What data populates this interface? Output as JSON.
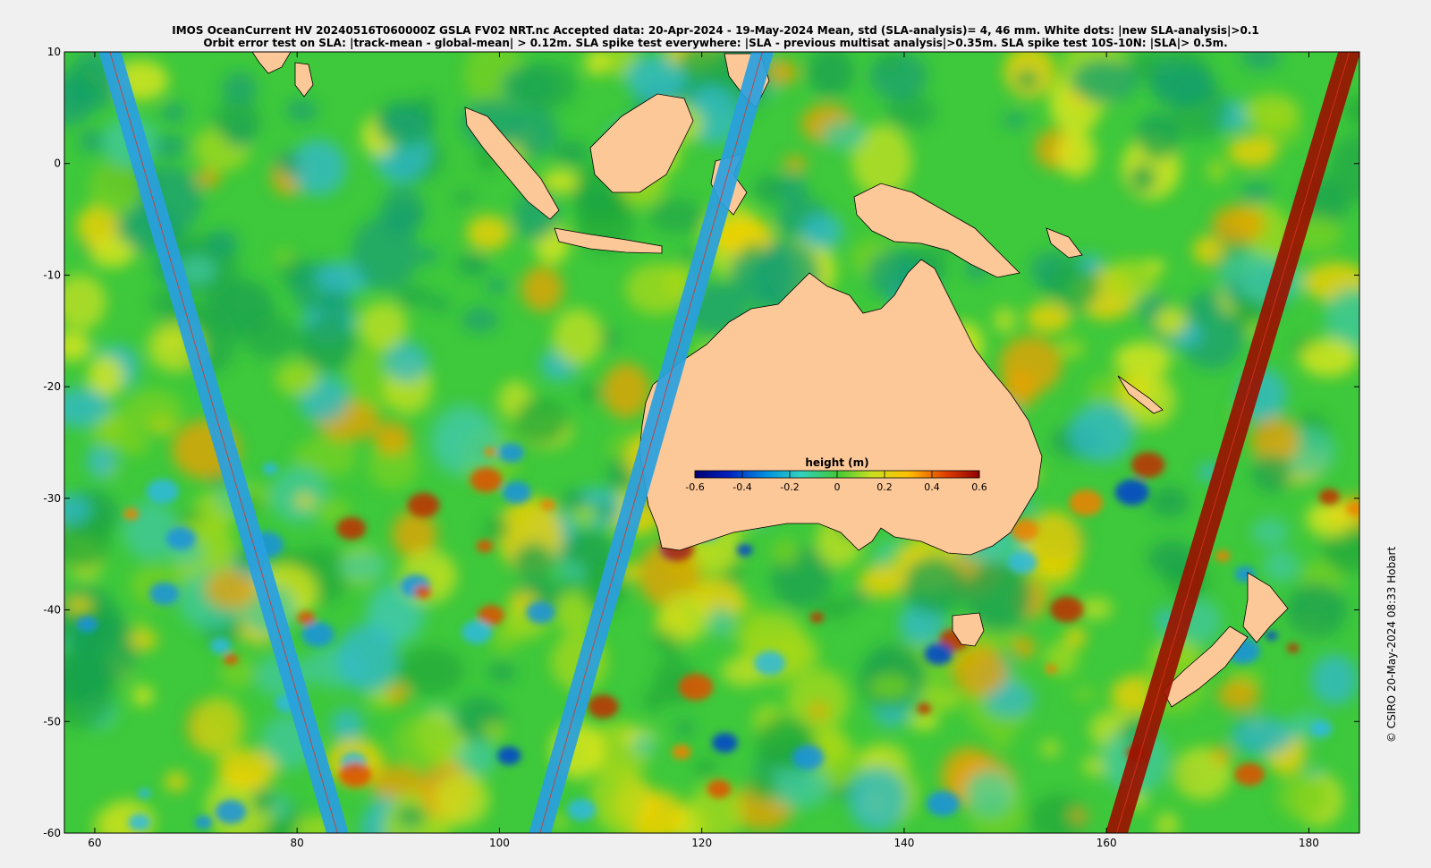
{
  "header": {
    "title_line1": "IMOS OceanCurrent HV 20240516T060000Z GSLA FV02 NRT.nc  Accepted data: 20-Apr-2024 - 19-May-2024 Mean, std (SLA-analysis)= 4, 46 mm. White dots: |new SLA-analysis|>0.1",
    "title_line2": "Orbit error test on SLA: |track-mean  - global-mean| > 0.12m.  SLA spike test everywhere: |SLA - previous multisat analysis|>0.35m. SLA spike test 10S-10N: |SLA|> 0.5m."
  },
  "map": {
    "x_ticks": [
      "60",
      "80",
      "100",
      "120",
      "140",
      "160",
      "180"
    ],
    "y_ticks": [
      "10",
      "0",
      "-10",
      "-20",
      "-30",
      "-40",
      "-50",
      "-60"
    ],
    "x_range": [
      57,
      185
    ],
    "y_range": [
      -60,
      10
    ],
    "colors": {
      "land": "#fcc898",
      "ocean_base": "#3ec83c",
      "frame": "#000000"
    }
  },
  "colorbar": {
    "title": "height (m)",
    "ticks": [
      "-0.6",
      "-0.4",
      "-0.2",
      "0",
      "0.2",
      "0.4",
      "0.6"
    ],
    "range": [
      -0.6,
      0.6
    ]
  },
  "tracks": [
    {
      "color": "#2aa0e0",
      "from": [
        61.5,
        10
      ],
      "to": [
        84,
        -60
      ]
    },
    {
      "color": "#2aa0e0",
      "from": [
        126,
        10
      ],
      "to": [
        104,
        -60
      ]
    },
    {
      "color": "#9a1200",
      "from": [
        184,
        10
      ],
      "to": [
        161,
        -60
      ]
    }
  ],
  "credit": "© CSIRO 20-May-2024 08:33 Hobart"
}
